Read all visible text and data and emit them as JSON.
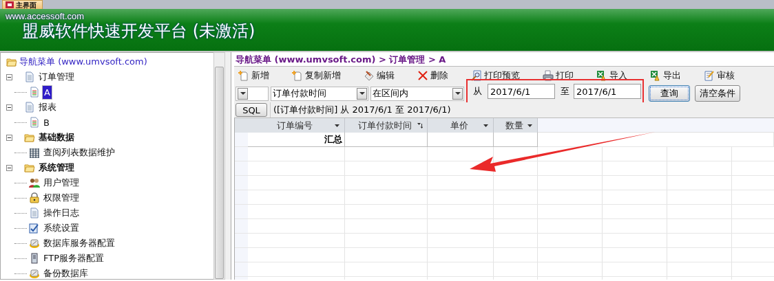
{
  "tab": {
    "label": "主界面"
  },
  "header": {
    "site": "www.accessoft.com",
    "title": "盟威软件快速开发平台 (未激活)"
  },
  "nav": {
    "root": "导航菜单 (www.umvsoft.com)",
    "items": [
      {
        "label": "订单管理",
        "kind": "doc",
        "bold": false,
        "expanded": true,
        "selected": false,
        "children": [
          {
            "label": "A",
            "kind": "report",
            "bold": false,
            "selected": true
          }
        ]
      },
      {
        "label": "报表",
        "kind": "doc",
        "bold": false,
        "expanded": true,
        "selected": false,
        "children": [
          {
            "label": "B",
            "kind": "report",
            "bold": false,
            "selected": false
          }
        ]
      },
      {
        "label": "基础数据",
        "kind": "folder",
        "bold": true,
        "expanded": true,
        "selected": false,
        "children": [
          {
            "label": "查阅列表数据维护",
            "kind": "grid",
            "bold": false,
            "selected": false
          }
        ]
      },
      {
        "label": "系统管理",
        "kind": "folder",
        "bold": true,
        "expanded": true,
        "selected": false,
        "children": [
          {
            "label": "用户管理",
            "kind": "users",
            "bold": false,
            "selected": false
          },
          {
            "label": "权限管理",
            "kind": "lock",
            "bold": false,
            "selected": false
          },
          {
            "label": "操作日志",
            "kind": "doc",
            "bold": false,
            "selected": false
          },
          {
            "label": "系统设置",
            "kind": "settings",
            "bold": false,
            "selected": false
          },
          {
            "label": "数据库服务器配置",
            "kind": "db",
            "bold": false,
            "selected": false
          },
          {
            "label": "FTP服务器配置",
            "kind": "server",
            "bold": false,
            "selected": false
          },
          {
            "label": "备份数据库",
            "kind": "db",
            "bold": false,
            "selected": false
          }
        ]
      }
    ]
  },
  "breadcrumb": "导航菜单 (www.umvsoft.com) > 订单管理 > A",
  "toolbar": [
    {
      "label": "新增",
      "kind": "add"
    },
    {
      "label": "复制新增",
      "kind": "add"
    },
    {
      "label": "编辑",
      "kind": "edit"
    },
    {
      "label": "删除",
      "kind": "delete"
    },
    {
      "label": "打印预览",
      "kind": "preview"
    },
    {
      "label": "打印",
      "kind": "print"
    },
    {
      "label": "导入",
      "kind": "excel"
    },
    {
      "label": "导出",
      "kind": "excel"
    },
    {
      "label": "审核",
      "kind": "audit"
    }
  ],
  "filter": {
    "field": "订单付款时间",
    "operator": "在区间内",
    "from_label": "从",
    "from": "2017/6/1",
    "to_label": "至",
    "to": "2017/6/1",
    "query_button": "查询",
    "clear_button": "清空条件"
  },
  "sql": {
    "button": "SQL",
    "text": "([订单付款时间] 从 2017/6/1 至 2017/6/1)"
  },
  "table": {
    "columns": [
      {
        "label": "订单编号",
        "kind": "filter"
      },
      {
        "label": "订单付款时间",
        "kind": "sorted"
      },
      {
        "label": "单价",
        "kind": "filter"
      },
      {
        "label": "数量",
        "kind": "filter"
      }
    ],
    "summary_label": "汇总"
  },
  "annotations": {
    "highlight_box": true,
    "arrow": true
  }
}
